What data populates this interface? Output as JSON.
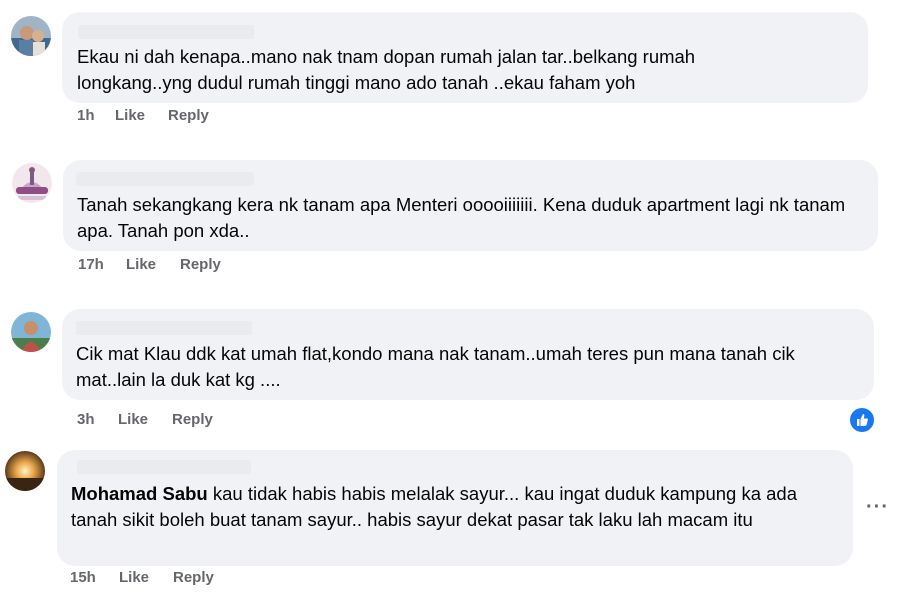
{
  "comments": [
    {
      "author": "",
      "text": "Ekau ni dah kenapa..mano nak tnam dopan rumah jalan tar..belkang rumah longkang..yng dudul rumah tinggi mano ado tanah ..ekau faham yoh",
      "time": "1h",
      "like_label": "Like",
      "reply_label": "Reply"
    },
    {
      "author": "",
      "text": "Tanah sekangkang kera nk tanam apa Menteri ooooiiiiiii. Kena duduk apartment lagi nk tanam apa. Tanah pon xda..",
      "time": "17h",
      "like_label": "Like",
      "reply_label": "Reply"
    },
    {
      "author": "",
      "text": "Cik mat Klau ddk kat umah flat,kondo mana nak tanam..umah teres pun mana tanah cik mat..lain la duk kat kg ....",
      "time": "3h",
      "like_label": "Like",
      "reply_label": "Reply",
      "reaction_icon": "like-reaction-icon",
      "reaction_color": "#1877f2"
    },
    {
      "author": "",
      "mention": "Mohamad Sabu",
      "text": " kau tidak habis habis melalak sayur... kau ingat duduk kampung ka ada tanah sikit boleh buat tanam sayur.. habis sayur dekat pasar tak laku lah macam itu",
      "time": "15h",
      "like_label": "Like",
      "reply_label": "Reply",
      "more_label": "···"
    }
  ],
  "colors": {
    "bubble": "#f0f2f5",
    "text": "#050505",
    "secondary": "#65676b",
    "accent": "#1877f2"
  }
}
